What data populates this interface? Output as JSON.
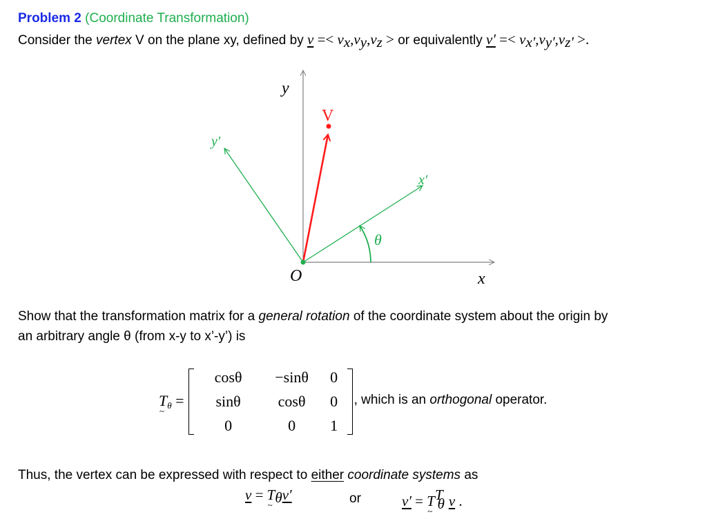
{
  "problem": {
    "label": "Problem 2",
    "subtitle": "(Coordinate Transformation)",
    "colors": {
      "label": "#1b2ae6",
      "subtitle": "#1fae4e"
    }
  },
  "intro": {
    "pre": "Consider the ",
    "vertex_word": "vertex",
    "mid": " V on the plane xy, defined by ",
    "vec": "v",
    "eq_open": " =< ",
    "comp1": "v",
    "comp1_sub": "x",
    "comp2": "v",
    "comp2_sub": "y",
    "comp3": "v",
    "comp3_sub": "z",
    "eq_close": " >",
    "or_text": " or equivalently ",
    "vec_prime": "v′",
    "eq2_open": " =< ",
    "pcomp1_sub": "x'",
    "pcomp2_sub": "y'",
    "pcomp3_sub": "z'",
    "eq2_close": " >."
  },
  "diagram": {
    "labels": {
      "y": "y",
      "x": "x",
      "origin": "O",
      "vertex": "V",
      "x_prime": "x′",
      "y_prime": "y′",
      "angle": "θ"
    },
    "colors": {
      "axes": "#808080",
      "rotated_axes": "#1fae4e",
      "vector": "#ff1a1a"
    },
    "rotation_angle_deg": 33
  },
  "question": {
    "line1_pre": "Show that the transformation matrix for a ",
    "line1_em": "general rotation",
    "line1_post": " of the coordinate system about the origin by",
    "line2": "an arbitrary angle θ (from x-y to x’-y’) is"
  },
  "matrix": {
    "lhs_symbol": "T",
    "lhs_sub": "θ",
    "equals": "=",
    "cells": [
      "cosθ",
      "−sinθ",
      "0",
      "sinθ",
      "cosθ",
      "0",
      "0",
      "0",
      "1"
    ],
    "tail_pre": ", which is an ",
    "tail_em": "orthogonal",
    "tail_post": " operator."
  },
  "conclusion": {
    "pre": "Thus, the vertex can be expressed with respect to ",
    "underlined": "either",
    "space": " ",
    "em": "coordinate systems",
    "post": " as"
  },
  "equations": {
    "eq1_lhs": "v",
    "eq1_eq": " = ",
    "eq1_T": "T",
    "eq1_sub": "θ",
    "eq1_rhs": "v′",
    "or": "or",
    "eq2_lhs": "v′",
    "eq2_eq": " = ",
    "eq2_T": "T",
    "eq2_sup": "T",
    "eq2_sub": "θ",
    "eq2_rhs": "v",
    "eq2_end": " ."
  }
}
